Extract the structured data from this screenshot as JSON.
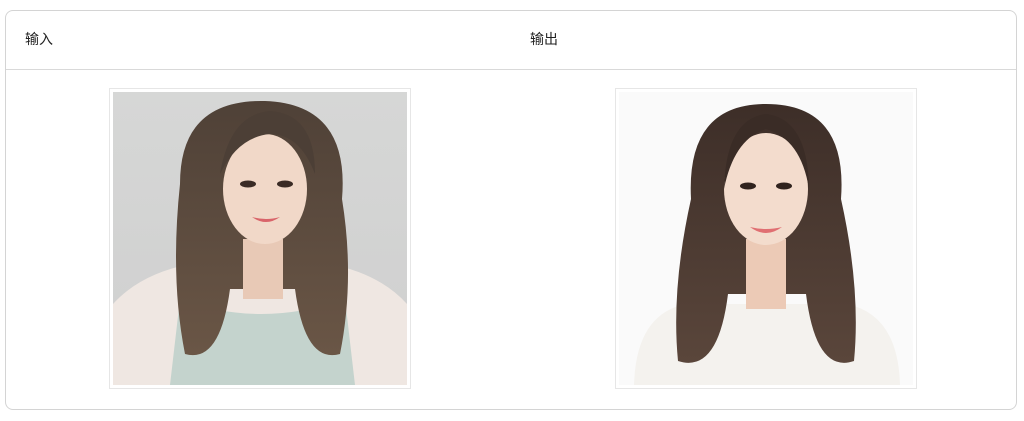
{
  "table": {
    "headers": [
      "输入",
      "输出"
    ]
  },
  "images": {
    "input": {
      "icon": "portrait-photo-input",
      "background_color": "#d2d3d3"
    },
    "output": {
      "icon": "portrait-photo-output",
      "background_color": "#fafafa"
    }
  }
}
